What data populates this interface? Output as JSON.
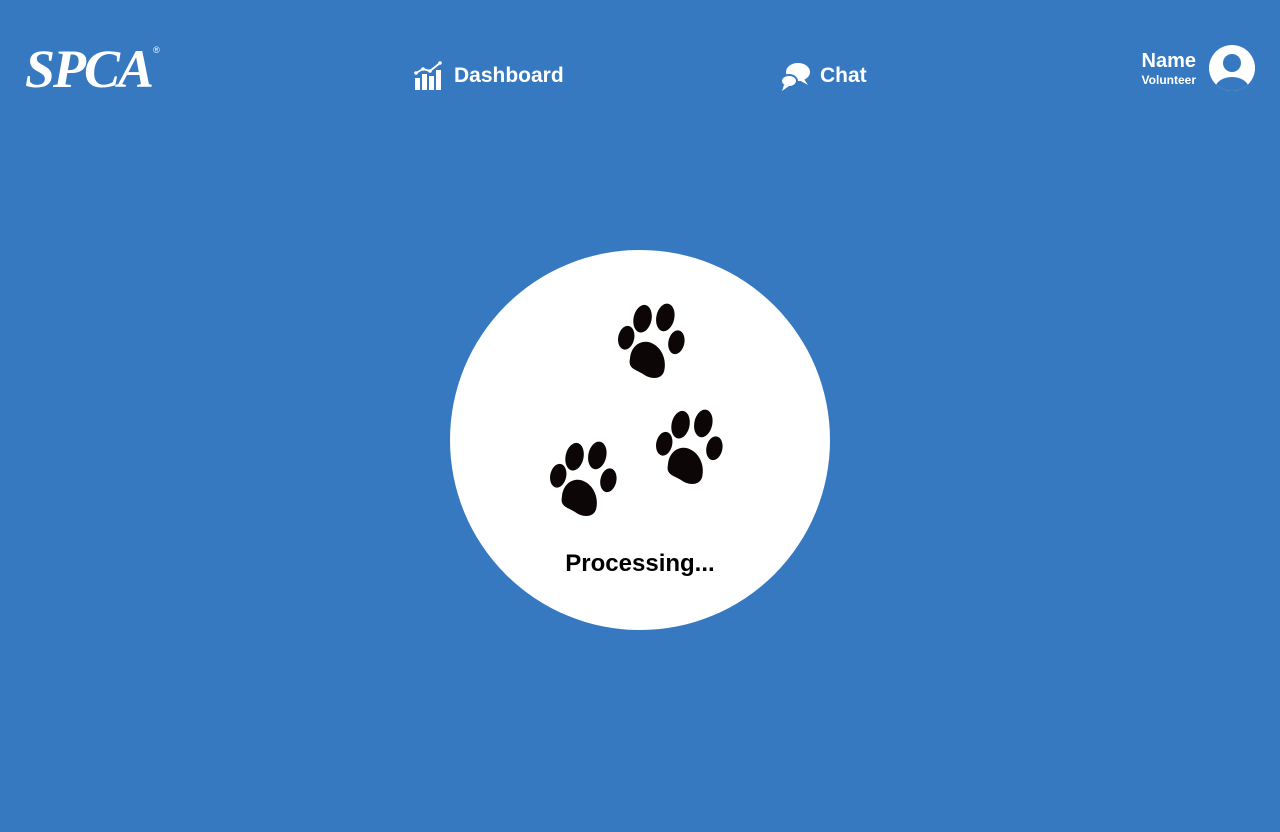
{
  "header": {
    "logo_text": "SPCA",
    "logo_mark": "®",
    "nav": {
      "dashboard": {
        "label": "Dashboard",
        "icon": "bar-chart-icon"
      },
      "chat": {
        "label": "Chat",
        "icon": "chat-bubbles-icon"
      }
    },
    "user": {
      "name": "Name",
      "role": "Volunteer",
      "icon": "user-avatar-icon"
    }
  },
  "main": {
    "status_text": "Processing...",
    "paw_icon": "paw-print-icon"
  },
  "colors": {
    "background": "#3679C1",
    "card": "#ffffff",
    "paw": "#0d0606",
    "text_light": "#ffffff",
    "text_dark": "#000000"
  }
}
